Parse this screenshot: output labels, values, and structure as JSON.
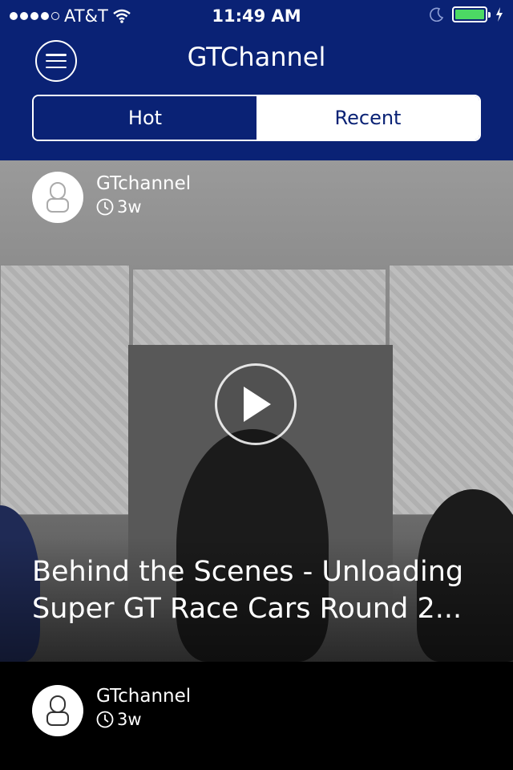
{
  "status_bar": {
    "carrier": "AT&T",
    "time": "11:49 AM",
    "signal_bars": 4,
    "battery_level": 1.0
  },
  "header": {
    "title": "GTChannel",
    "tabs": [
      {
        "label": "Hot",
        "active": true
      },
      {
        "label": "Recent",
        "active": false
      }
    ]
  },
  "feed": [
    {
      "author": "GTchannel",
      "age": "3w",
      "title": "Behind the Scenes - Unloading Super GT Race Cars Round 2..."
    },
    {
      "author": "GTchannel",
      "age": "3w"
    }
  ],
  "colors": {
    "brand_blue": "#0a2275",
    "battery_green": "#4cd964"
  }
}
